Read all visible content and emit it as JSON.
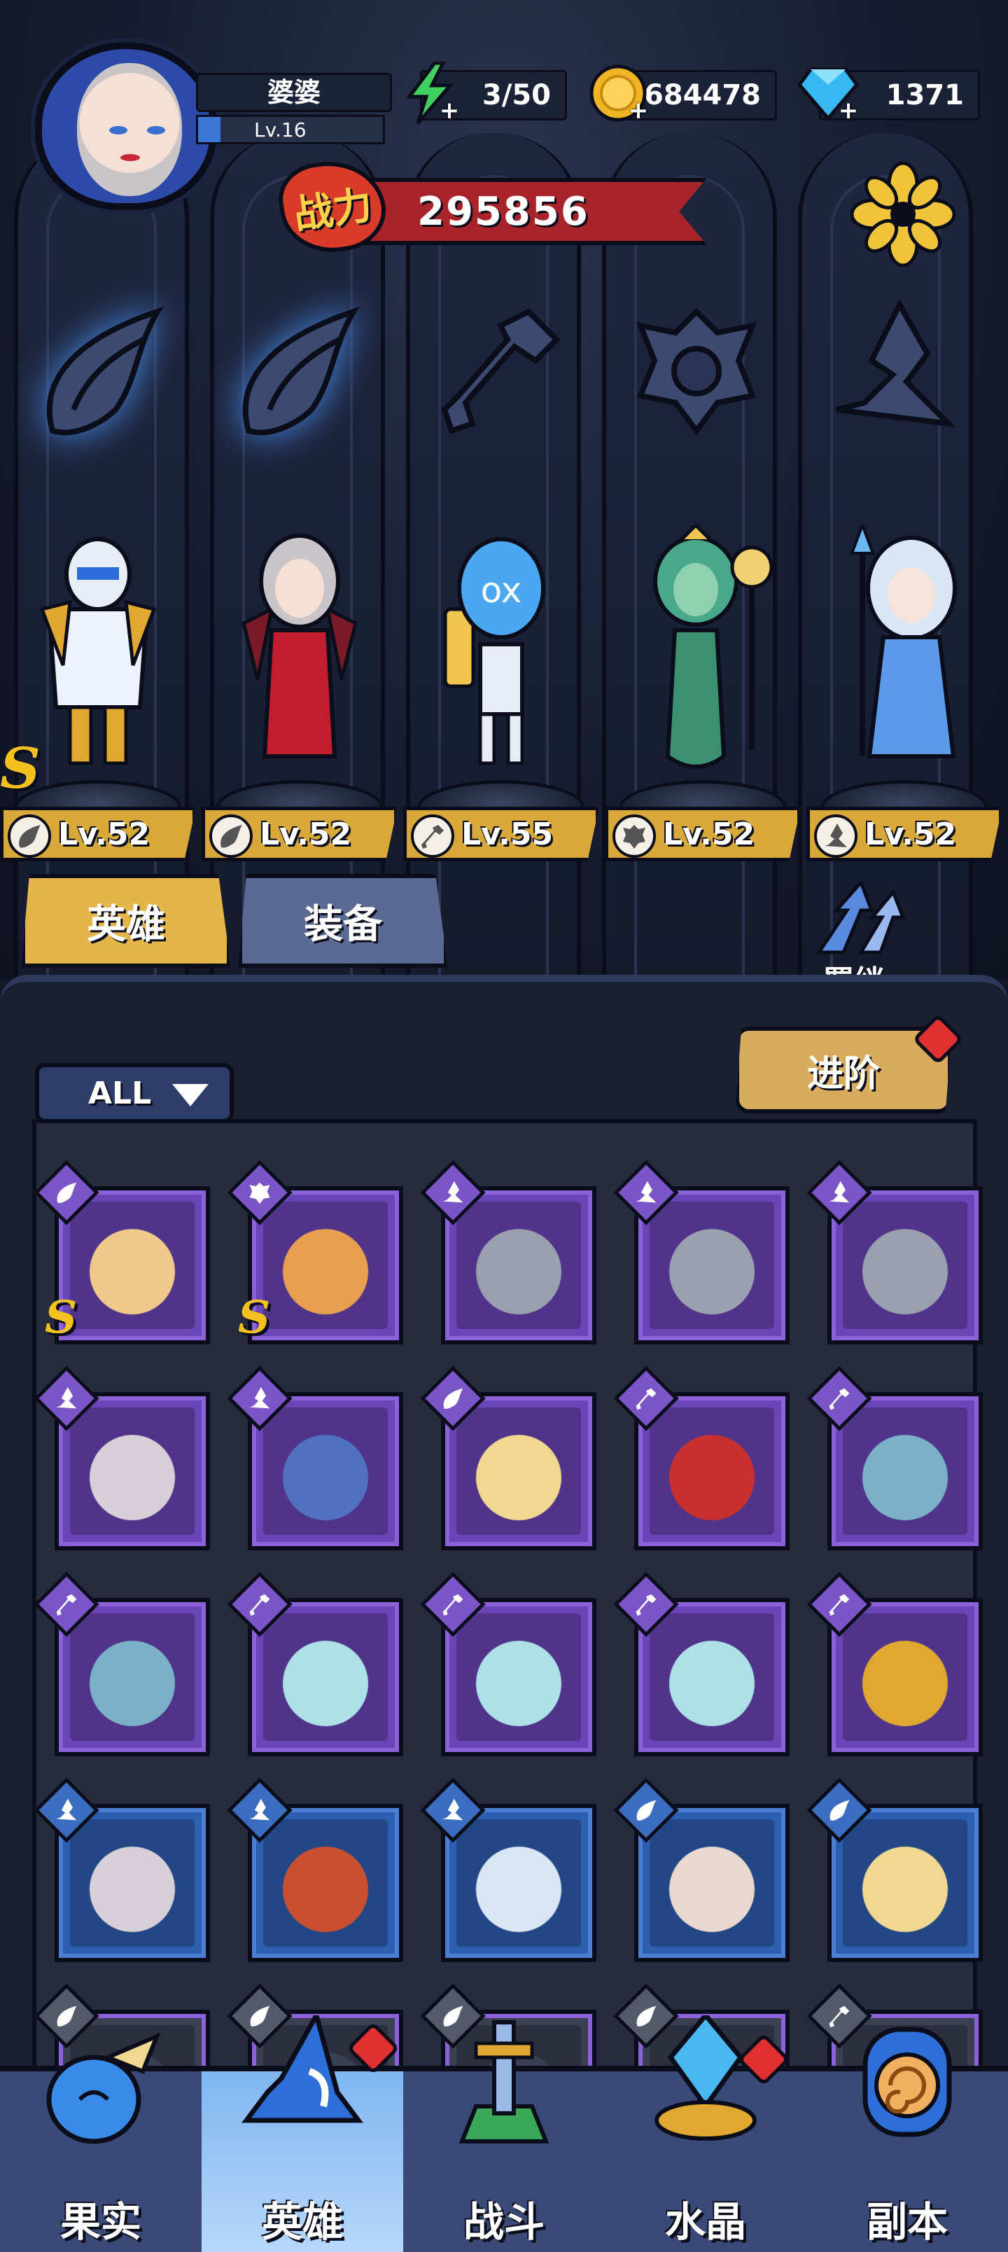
{
  "player": {
    "name": "婆婆",
    "level_label": "Lv.16",
    "level_progress": 0.12
  },
  "resources": {
    "energy": "3/50",
    "gold": "684478",
    "diamonds": "1371",
    "energy_icon": "lightning-icon",
    "gold_icon": "coin-icon",
    "diamond_icon": "diamond-icon"
  },
  "power": {
    "badge": "战力",
    "value": "295856"
  },
  "emblems": [
    {
      "icon": "wing-icon",
      "active": true
    },
    {
      "icon": "wing-icon",
      "active": true
    },
    {
      "icon": "wrench-icon",
      "active": false
    },
    {
      "icon": "beast-icon",
      "active": false
    },
    {
      "icon": "wizard-hat-icon",
      "active": false
    }
  ],
  "lineup": [
    {
      "level": "Lv.52",
      "class_icon": "wing-icon",
      "rank": "S"
    },
    {
      "level": "Lv.52",
      "class_icon": "wing-icon",
      "rank": ""
    },
    {
      "level": "Lv.55",
      "class_icon": "wrench-icon",
      "rank": ""
    },
    {
      "level": "Lv.52",
      "class_icon": "beast-icon",
      "rank": ""
    },
    {
      "level": "Lv.52",
      "class_icon": "wizard-hat-icon",
      "rank": ""
    }
  ],
  "tabs": {
    "heroes": "英雄",
    "equipment": "装备"
  },
  "bond_label": "羁绊",
  "filter_label": "ALL",
  "advance_label": "进阶",
  "colors": {
    "accent_gold": "#e3b54a",
    "rarity_purple": "#6a45b8",
    "rarity_blue": "#2d5fb0",
    "notification_red": "#e03030"
  },
  "hero_cards": [
    {
      "rarity": "purple",
      "class_icon": "wing-icon",
      "rank": "S"
    },
    {
      "rarity": "purple",
      "class_icon": "beast-icon",
      "rank": "S"
    },
    {
      "rarity": "purple",
      "class_icon": "wizard-hat-icon",
      "rank": ""
    },
    {
      "rarity": "purple",
      "class_icon": "wizard-hat-icon",
      "rank": ""
    },
    {
      "rarity": "purple",
      "class_icon": "wizard-hat-icon",
      "rank": ""
    },
    {
      "rarity": "purple",
      "class_icon": "wizard-hat-icon",
      "rank": ""
    },
    {
      "rarity": "purple",
      "class_icon": "wizard-hat-icon",
      "rank": ""
    },
    {
      "rarity": "purple",
      "class_icon": "wing-icon",
      "rank": ""
    },
    {
      "rarity": "purple",
      "class_icon": "wrench-icon",
      "rank": ""
    },
    {
      "rarity": "purple",
      "class_icon": "wrench-icon",
      "rank": ""
    },
    {
      "rarity": "purple",
      "class_icon": "wrench-icon",
      "rank": ""
    },
    {
      "rarity": "purple",
      "class_icon": "wrench-icon",
      "rank": ""
    },
    {
      "rarity": "purple",
      "class_icon": "wrench-icon",
      "rank": ""
    },
    {
      "rarity": "purple",
      "class_icon": "wrench-icon",
      "rank": ""
    },
    {
      "rarity": "purple",
      "class_icon": "wrench-icon",
      "rank": ""
    },
    {
      "rarity": "blue",
      "class_icon": "wizard-hat-icon",
      "rank": ""
    },
    {
      "rarity": "blue",
      "class_icon": "wizard-hat-icon",
      "rank": ""
    },
    {
      "rarity": "blue",
      "class_icon": "wizard-hat-icon",
      "rank": ""
    },
    {
      "rarity": "blue",
      "class_icon": "wing-icon",
      "rank": ""
    },
    {
      "rarity": "blue",
      "class_icon": "wing-icon",
      "rank": ""
    },
    {
      "rarity": "grey",
      "class_icon": "wing-icon",
      "rank": ""
    },
    {
      "rarity": "grey",
      "class_icon": "wing-icon",
      "rank": ""
    },
    {
      "rarity": "grey",
      "class_icon": "wing-icon",
      "rank": ""
    },
    {
      "rarity": "grey",
      "class_icon": "wing-icon",
      "rank": ""
    },
    {
      "rarity": "grey",
      "class_icon": "wrench-icon",
      "rank": ""
    }
  ],
  "nav": [
    {
      "label": "果实",
      "icon": "fruit-icon",
      "active": false,
      "badge": false
    },
    {
      "label": "英雄",
      "icon": "hero-hat-icon",
      "active": true,
      "badge": true
    },
    {
      "label": "战斗",
      "icon": "sword-icon",
      "active": false,
      "badge": false
    },
    {
      "label": "水晶",
      "icon": "crystal-icon",
      "active": false,
      "badge": true
    },
    {
      "label": "副本",
      "icon": "portal-icon",
      "active": false,
      "badge": false
    }
  ]
}
